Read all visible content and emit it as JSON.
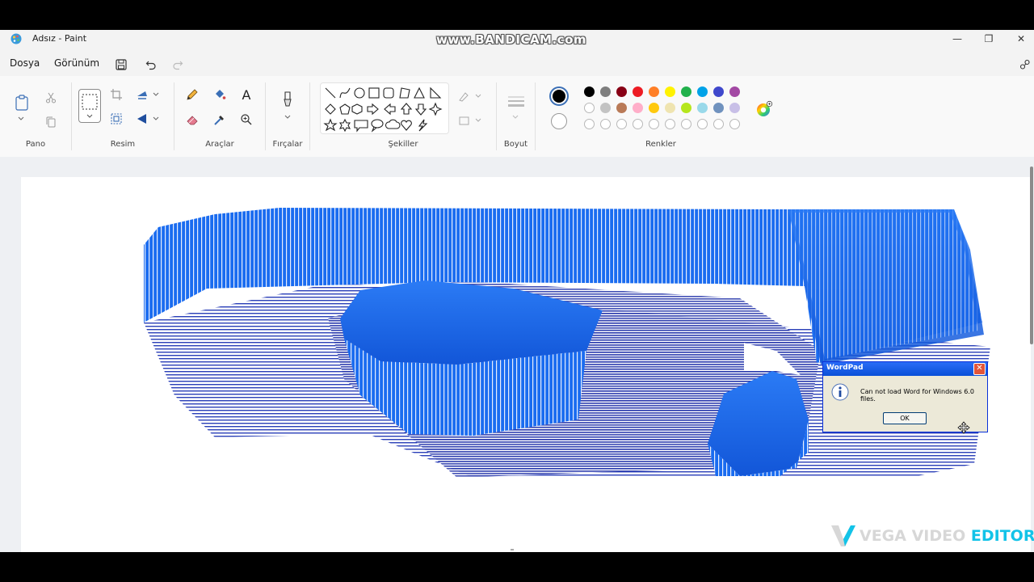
{
  "window": {
    "title": "Adsız - Paint",
    "minimize": "—",
    "maximize": "❐",
    "close": "✕"
  },
  "recorder_watermark": "www.BANDICAM.com",
  "menu": {
    "file": "Dosya",
    "view": "Görünüm"
  },
  "ribbon": {
    "clipboard_label": "Pano",
    "image_label": "Resim",
    "tools_label": "Araçlar",
    "brushes_label": "Fırçalar",
    "shapes_label": "Şekiller",
    "size_label": "Boyut",
    "colors_label": "Renkler",
    "text_tool_glyph": "A"
  },
  "palette": {
    "primary": "#000000",
    "secondary": "#ffffff",
    "row1": [
      "#000000",
      "#7f7f7f",
      "#880015",
      "#ed1c24",
      "#ff7f27",
      "#fff200",
      "#22b14c",
      "#00a2e8",
      "#3f48cc",
      "#a349a4"
    ],
    "row2": [
      "#ffffff",
      "#c3c3c3",
      "#b97a57",
      "#ffaec9",
      "#ffc90e",
      "#efe4b0",
      "#b5e61d",
      "#99d9ea",
      "#7092be",
      "#c8bfe7"
    ]
  },
  "dialog": {
    "title": "WordPad",
    "message": "Can not load Word for Windows 6.0 files.",
    "ok_label": "OK",
    "close_glyph": "✕"
  },
  "editor_watermark": {
    "part1": "VEGA VIDEO ",
    "part2": "EDITOR"
  }
}
